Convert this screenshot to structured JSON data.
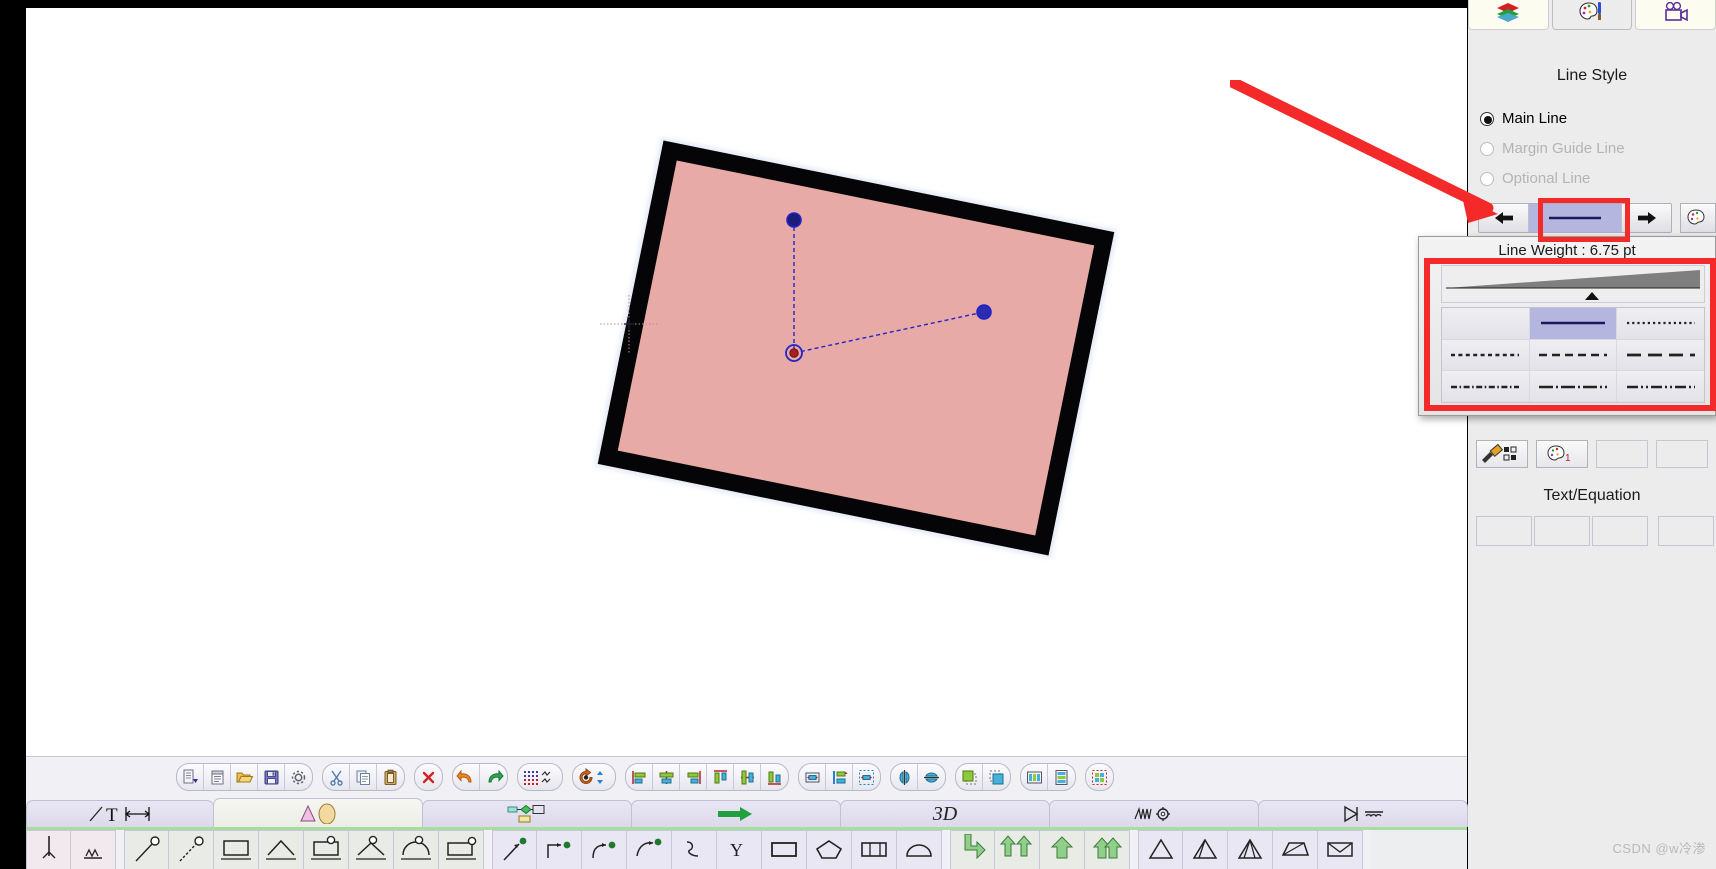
{
  "app": {
    "watermark": "CSDN @w冷渗"
  },
  "right_panel": {
    "tabs": [
      {
        "name": "layers-tab",
        "icon": "layers-icon",
        "active": false
      },
      {
        "name": "style-tab",
        "icon": "palette-brush-icon",
        "active": true
      },
      {
        "name": "animation-tab",
        "icon": "video-camera-icon",
        "active": false
      }
    ],
    "line_style": {
      "title": "Line Style",
      "options": [
        {
          "label": "Main Line",
          "selected": true,
          "enabled": true
        },
        {
          "label": "Margin Guide Line",
          "selected": false,
          "enabled": false
        },
        {
          "label": "Optional Line",
          "selected": false,
          "enabled": false
        }
      ],
      "prev_button": "◀",
      "next_button": "▶",
      "preview_style": "solid",
      "color_button_icon": "palette-icon"
    },
    "popup": {
      "line_weight_label": "Line Weight : 6.75 pt",
      "slider_marker": "▲",
      "styles": [
        {
          "id": "blank",
          "pattern": "none",
          "selected": false
        },
        {
          "id": "solid",
          "pattern": "solid",
          "selected": true
        },
        {
          "id": "fine-dotted",
          "pattern": "dotted-fine",
          "selected": false
        },
        {
          "id": "short-dash",
          "pattern": "dash-short",
          "selected": false
        },
        {
          "id": "medium-dash",
          "pattern": "dash-medium",
          "selected": false
        },
        {
          "id": "long-dash",
          "pattern": "dash-long",
          "selected": false
        },
        {
          "id": "dash-dot-fine",
          "pattern": "dash-dot-fine",
          "selected": false
        },
        {
          "id": "dash-dot",
          "pattern": "dash-dot",
          "selected": false
        },
        {
          "id": "dash-dot-dot",
          "pattern": "dash-dot-dot",
          "selected": false
        }
      ]
    },
    "action_buttons": [
      {
        "name": "format-painter-button",
        "icon": "brush-grid-icon"
      },
      {
        "name": "color-set-1-button",
        "icon": "palette-1-icon"
      },
      {
        "name": "blank-button-1",
        "icon": ""
      },
      {
        "name": "blank-button-2",
        "icon": ""
      }
    ],
    "text_equation": {
      "title": "Text/Equation",
      "cells": [
        "",
        "",
        "",
        ""
      ]
    }
  },
  "toolbar": {
    "groups": [
      {
        "name": "file-group",
        "buttons": [
          {
            "name": "new-document-button",
            "icon": "new-doc-icon"
          },
          {
            "name": "notes-button",
            "icon": "notepad-icon"
          },
          {
            "name": "open-button",
            "icon": "folder-open-icon"
          },
          {
            "name": "save-button",
            "icon": "floppy-save-icon"
          },
          {
            "name": "settings-button",
            "icon": "gear-icon"
          }
        ]
      },
      {
        "name": "clipboard-group",
        "buttons": [
          {
            "name": "cut-button",
            "icon": "scissors-icon"
          },
          {
            "name": "copy-button",
            "icon": "copy-icon"
          },
          {
            "name": "paste-button",
            "icon": "clipboard-icon"
          }
        ]
      },
      {
        "name": "delete-group",
        "buttons": [
          {
            "name": "delete-button",
            "icon": "red-x-icon"
          }
        ]
      },
      {
        "name": "history-group",
        "buttons": [
          {
            "name": "undo-button",
            "icon": "undo-arrow-icon"
          },
          {
            "name": "redo-button",
            "icon": "redo-arrow-icon"
          }
        ]
      },
      {
        "name": "grid-group",
        "buttons": [
          {
            "name": "grid-snap-button",
            "icon": "grid-dots-icon"
          }
        ]
      },
      {
        "name": "rotate-group",
        "buttons": [
          {
            "name": "rotate-button",
            "icon": "rotate-icon"
          }
        ]
      },
      {
        "name": "align-group",
        "buttons": [
          {
            "name": "align-left-button",
            "icon": "align-left-icon"
          },
          {
            "name": "align-center-h-button",
            "icon": "align-center-h-icon"
          },
          {
            "name": "align-right-button",
            "icon": "align-right-icon"
          },
          {
            "name": "align-top-button",
            "icon": "align-top-icon"
          },
          {
            "name": "align-middle-v-button",
            "icon": "align-middle-v-icon"
          },
          {
            "name": "align-bottom-button",
            "icon": "align-bottom-icon"
          }
        ]
      },
      {
        "name": "distribute-group",
        "buttons": [
          {
            "name": "distribute-h-button",
            "icon": "distribute-h-icon"
          },
          {
            "name": "distribute-v-button",
            "icon": "distribute-v-icon"
          },
          {
            "name": "fit-selection-button",
            "icon": "fit-selection-icon"
          }
        ]
      },
      {
        "name": "flip-group",
        "buttons": [
          {
            "name": "flip-horizontal-button",
            "icon": "flip-h-icon"
          },
          {
            "name": "flip-vertical-button",
            "icon": "flip-v-icon"
          }
        ]
      },
      {
        "name": "order-group",
        "buttons": [
          {
            "name": "bring-front-button",
            "icon": "bring-front-icon"
          },
          {
            "name": "send-back-button",
            "icon": "send-back-icon"
          }
        ]
      },
      {
        "name": "arrange-group",
        "buttons": [
          {
            "name": "columns-button",
            "icon": "columns-icon"
          },
          {
            "name": "rows-button",
            "icon": "rows-icon"
          }
        ]
      },
      {
        "name": "group-group",
        "buttons": [
          {
            "name": "group-objects-button",
            "icon": "group-icon"
          }
        ]
      }
    ]
  },
  "tabs": [
    {
      "name": "tab-text-dimension",
      "label": "",
      "icon": "line-text-dimension-icon",
      "active": false
    },
    {
      "name": "tab-shapes",
      "label": "",
      "icon": "triangle-ellipse-icon",
      "active": true
    },
    {
      "name": "tab-connectors",
      "label": "",
      "icon": "node-connector-icon",
      "active": false
    },
    {
      "name": "tab-arrows",
      "label": "",
      "icon": "green-arrow-icon",
      "active": false
    },
    {
      "name": "tab-3d",
      "label": "3D",
      "icon": "",
      "active": false
    },
    {
      "name": "tab-physics",
      "label": "",
      "icon": "spring-gear-icon",
      "active": false
    },
    {
      "name": "tab-circuits",
      "label": "",
      "icon": "diode-coil-icon",
      "active": false
    }
  ],
  "palette": {
    "groups": [
      {
        "name": "mechanics-left-group",
        "tone": "pink",
        "cells": [
          {
            "name": "pendulum-support-tool",
            "icon": "support-rod-icon"
          },
          {
            "name": "spring-tool",
            "icon": "spring-icon"
          }
        ]
      },
      {
        "name": "pendulum-group",
        "tone": "green",
        "cells": [
          {
            "name": "rod-ball-tool",
            "icon": "rod-ball-icon"
          },
          {
            "name": "string-ball-tool",
            "icon": "string-ball-icon"
          },
          {
            "name": "block-tool",
            "icon": "block-icon"
          },
          {
            "name": "incline-tool",
            "icon": "incline-icon"
          },
          {
            "name": "block-pulley-tool",
            "icon": "block-pulley-icon"
          },
          {
            "name": "wedge-ball-tool",
            "icon": "wedge-ball-icon"
          },
          {
            "name": "dome-ball-tool",
            "icon": "dome-ball-icon"
          },
          {
            "name": "table-ball-tool",
            "icon": "table-ball-icon"
          }
        ]
      },
      {
        "name": "vector-group",
        "tone": "plain",
        "cells": [
          {
            "name": "vector-tool",
            "icon": "vector-arrow-icon"
          },
          {
            "name": "step-vector-tool",
            "icon": "step-vector-icon"
          },
          {
            "name": "curve-vector-tool",
            "icon": "curve-vector-icon"
          },
          {
            "name": "arc-vector-tool",
            "icon": "arc-vector-icon"
          },
          {
            "name": "curve-tool",
            "icon": "curve-icon"
          },
          {
            "name": "y-axis-tool",
            "icon": "y-axis-icon"
          },
          {
            "name": "rect-tool",
            "icon": "rectangle-icon"
          },
          {
            "name": "pentagon-tool",
            "icon": "pentagon-icon"
          },
          {
            "name": "split-rect-tool",
            "icon": "split-rect-icon"
          },
          {
            "name": "dome-tool",
            "icon": "dome-icon"
          }
        ]
      },
      {
        "name": "flow-group",
        "tone": "green",
        "cells": [
          {
            "name": "flow-right-tool",
            "icon": "flow-right-icon"
          },
          {
            "name": "flow-split-tool",
            "icon": "flow-split-icon"
          },
          {
            "name": "flow-up-tool",
            "icon": "flow-up-icon"
          },
          {
            "name": "flow-up-double-tool",
            "icon": "flow-up-double-icon"
          }
        ]
      },
      {
        "name": "optics-group",
        "tone": "lavender",
        "cells": [
          {
            "name": "prism-tool",
            "icon": "prism-icon"
          },
          {
            "name": "prism-ray-tool",
            "icon": "prism-ray-icon"
          },
          {
            "name": "prism-double-ray-tool",
            "icon": "prism-double-ray-icon"
          },
          {
            "name": "trapezoid-tool",
            "icon": "trapezoid-icon"
          },
          {
            "name": "envelope-tool",
            "icon": "envelope-icon"
          }
        ]
      }
    ]
  },
  "canvas": {
    "selected_object": {
      "name": "rounded-rectangle-frame",
      "fill_color": "#e8aaa6",
      "stroke_color": "#050507",
      "rotation_deg": 11.5
    },
    "handles": [
      {
        "name": "rotation-handle",
        "color": "#2a2a8c"
      },
      {
        "name": "scale-handle",
        "color": "#2a2a8c"
      },
      {
        "name": "center-handle",
        "color": "#c02020"
      }
    ],
    "crosshair": {
      "name": "crosshair-marker",
      "color": "#c08a80"
    }
  },
  "annotations": {
    "arrow_color": "#f42a2a",
    "box_color": "#f42a2a"
  }
}
